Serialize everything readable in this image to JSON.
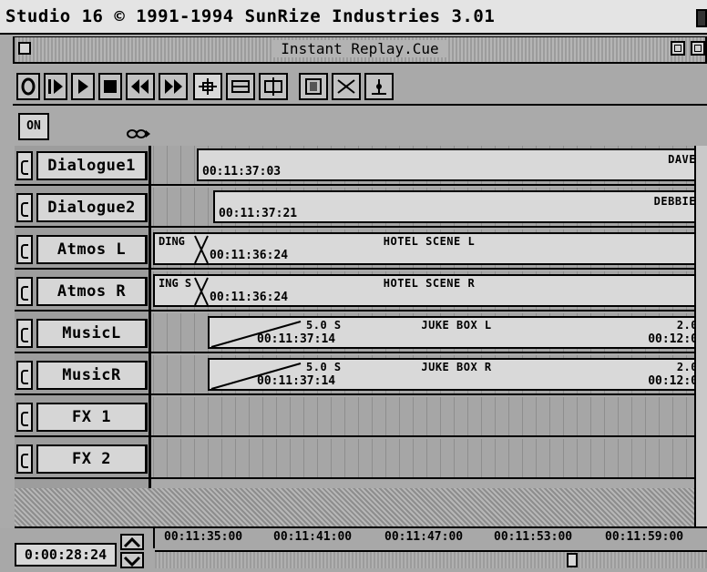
{
  "screen_title": "Studio 16 © 1991-1994 SunRize Industries 3.01",
  "window_title": "Instant Replay.Cue",
  "on_button": "ON",
  "tracks": [
    {
      "name": "Dialogue1",
      "header": "",
      "timecode": "00:11:37:03",
      "region": "DAVE",
      "fade": "",
      "end_label": "",
      "end_tc": ""
    },
    {
      "name": "Dialogue2",
      "header": "",
      "timecode": "00:11:37:21",
      "region": "DEBBIE",
      "fade": "",
      "end_label": "",
      "end_tc": ""
    },
    {
      "name": "Atmos L",
      "header": "DING",
      "timecode": "00:11:36:24",
      "region": "HOTEL SCENE L",
      "fade": "",
      "end_label": "",
      "end_tc": ""
    },
    {
      "name": "Atmos R",
      "header": "ING S",
      "timecode": "00:11:36:24",
      "region": "HOTEL SCENE R",
      "fade": "",
      "end_label": "",
      "end_tc": ""
    },
    {
      "name": "MusicL",
      "header": "",
      "timecode": "00:11:37:14",
      "region": "JUKE BOX L",
      "fade": "5.0 S",
      "end_label": "2.0",
      "end_tc": "00:12:0"
    },
    {
      "name": "MusicR",
      "header": "",
      "timecode": "00:11:37:14",
      "region": "JUKE BOX R",
      "fade": "5.0 S",
      "end_label": "2.0",
      "end_tc": "00:12:0"
    },
    {
      "name": "FX 1",
      "header": "",
      "timecode": "",
      "region": "",
      "fade": "",
      "end_label": "",
      "end_tc": ""
    },
    {
      "name": "FX 2",
      "header": "",
      "timecode": "",
      "region": "",
      "fade": "",
      "end_label": "",
      "end_tc": ""
    }
  ],
  "counter": "0:00:28:24",
  "ruler_ticks": [
    "00:11:35:00",
    "00:11:41:00",
    "00:11:47:00",
    "00:11:53:00",
    "00:11:59:00"
  ],
  "toolbar_icons": [
    "record-icon",
    "play-from-start-icon",
    "play-icon",
    "stop-icon",
    "rewind-icon",
    "fast-forward-icon",
    "move-region-icon",
    "trim-region-icon",
    "split-region-icon",
    "select-range-icon",
    "crossfade-icon",
    "marker-icon"
  ]
}
